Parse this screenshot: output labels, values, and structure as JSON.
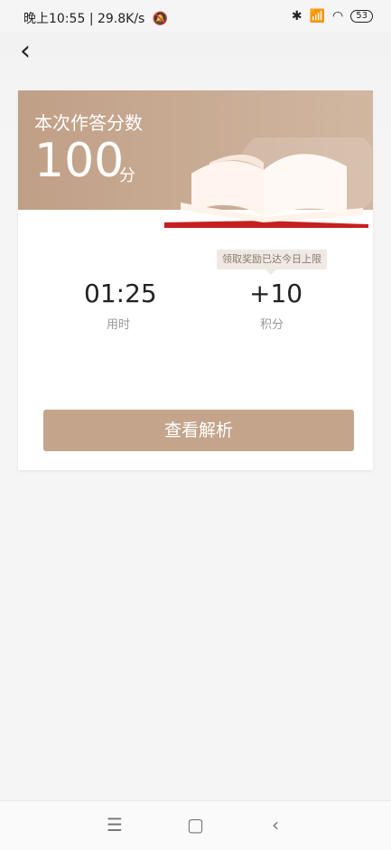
{
  "status_bar": {
    "time": "晚上10:55",
    "network_speed": "29.8K/s",
    "battery_level": "53"
  },
  "header": {
    "back_icon": "chevron-left-icon"
  },
  "result": {
    "title": "本次作答分数",
    "score": "100",
    "score_unit": "分"
  },
  "reward": {
    "tooltip": "领取奖励已达今日上限",
    "time_value": "01:25",
    "time_label": "用时",
    "points_value": "+10",
    "points_label": "积分"
  },
  "actions": {
    "view_analysis": "查看解析"
  },
  "navigation": {
    "menu_icon": "menu-icon",
    "home_icon": "square-icon",
    "back_icon": "back-icon"
  },
  "colors": {
    "accent": "#c4a58c",
    "tooltip_bg": "#efe9e4"
  }
}
